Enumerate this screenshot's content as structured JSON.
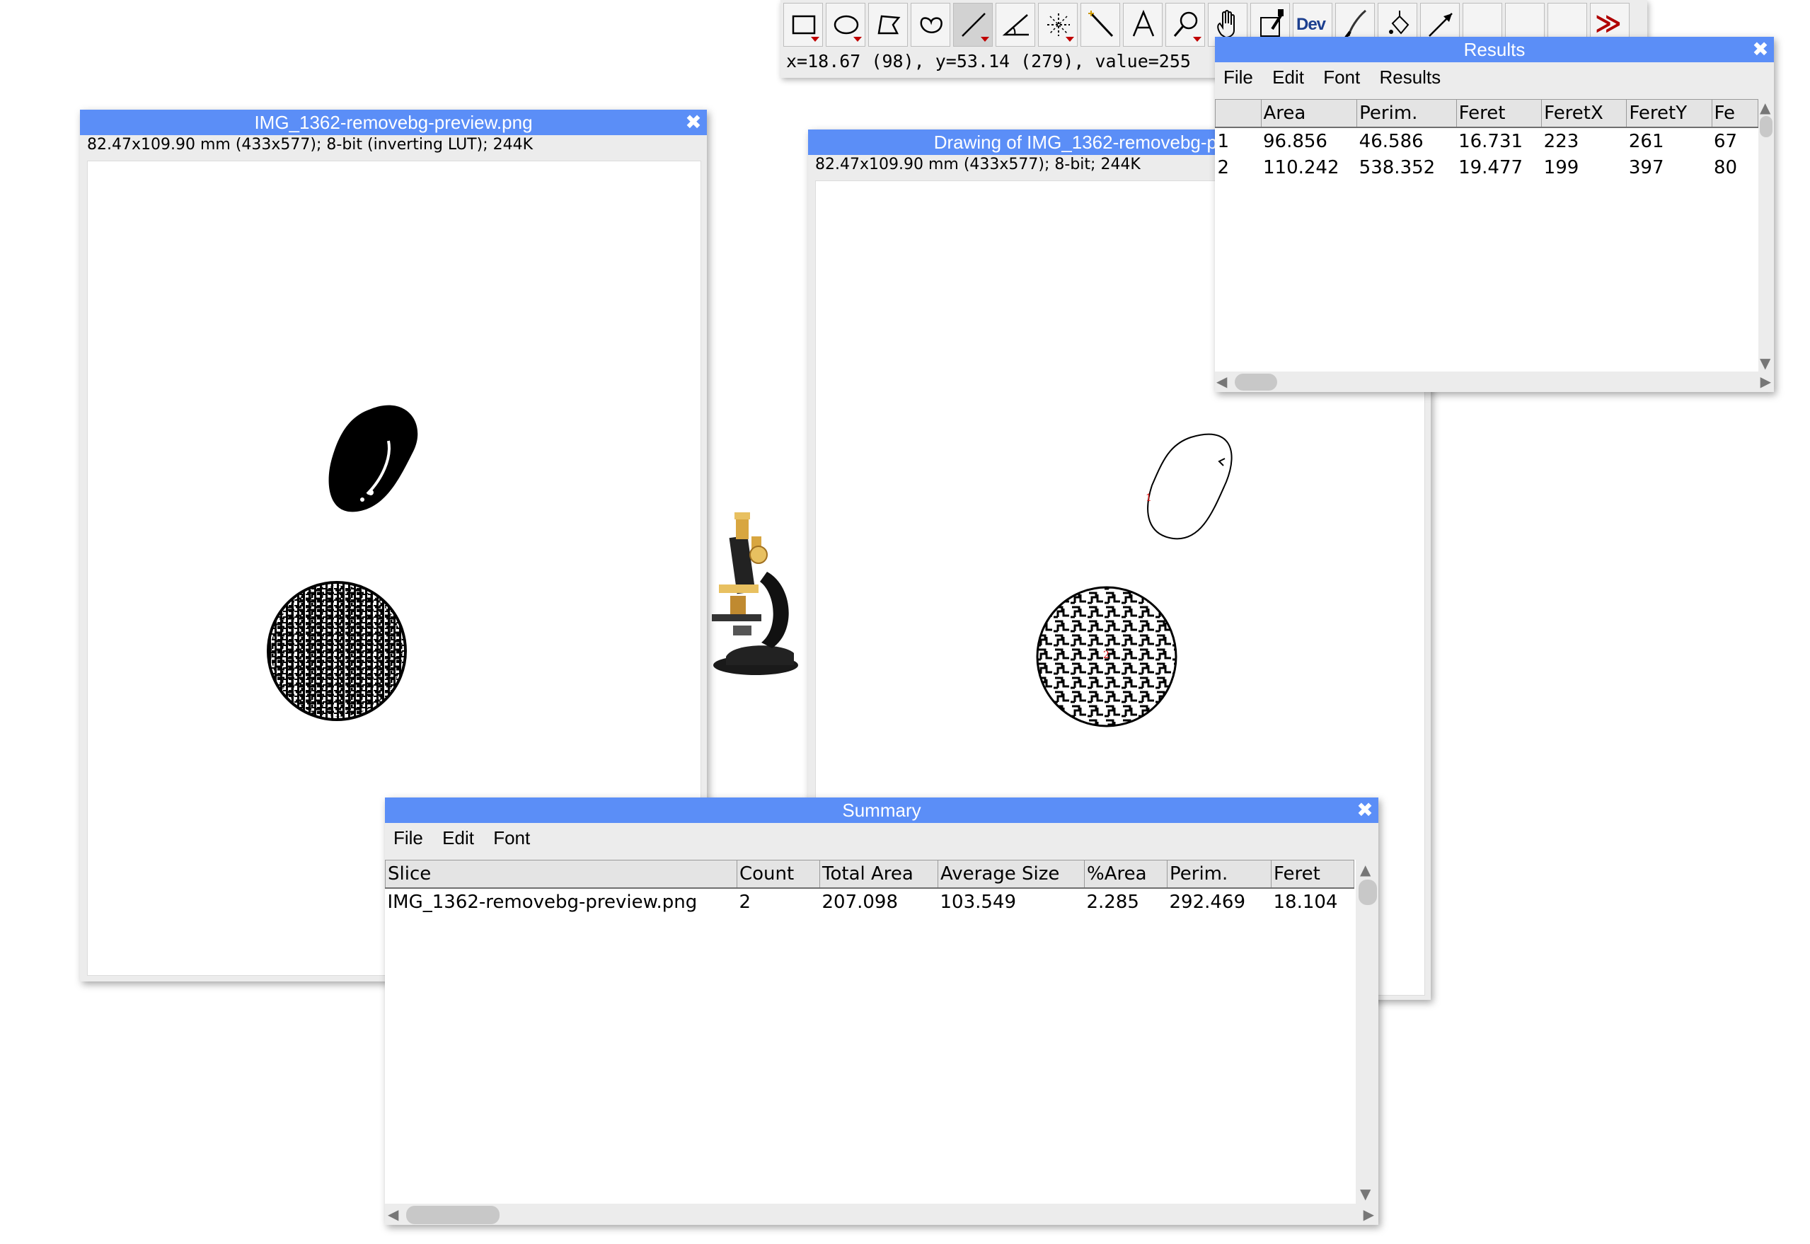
{
  "toolbar": {
    "status": "x=18.67 (98), y=53.14 (279), value=255",
    "tools": [
      {
        "name": "rectangle-tool-icon"
      },
      {
        "name": "oval-tool-icon"
      },
      {
        "name": "polygon-tool-icon"
      },
      {
        "name": "freehand-tool-icon"
      },
      {
        "name": "line-tool-icon"
      },
      {
        "name": "angle-tool-icon"
      },
      {
        "name": "point-tool-icon"
      },
      {
        "name": "wand-tool-icon"
      },
      {
        "name": "text-tool-icon"
      },
      {
        "name": "magnifier-tool-icon"
      },
      {
        "name": "hand-tool-icon"
      },
      {
        "name": "color-picker-tool-icon"
      },
      {
        "name": "dev-menu-icon",
        "label": "Dev"
      },
      {
        "name": "brush-tool-icon"
      },
      {
        "name": "flood-fill-tool-icon"
      },
      {
        "name": "arrow-tool-icon"
      },
      {
        "name": "empty-slot-1"
      },
      {
        "name": "empty-slot-2"
      },
      {
        "name": "empty-slot-3"
      },
      {
        "name": "more-tools-icon",
        "label": "≫"
      }
    ],
    "dev_label": "Dev",
    "more_label": "≫"
  },
  "original_window": {
    "title": "IMG_1362-removebg-preview.png",
    "info": "82.47x109.90 mm (433x577); 8-bit (inverting LUT); 244K"
  },
  "drawing_window": {
    "title": "Drawing of IMG_1362-removebg-preview.png",
    "info": "82.47x109.90 mm (433x577); 8-bit; 244K",
    "labels": [
      "1",
      "2"
    ]
  },
  "results_window": {
    "title": "Results",
    "menu": [
      "File",
      "Edit",
      "Font",
      "Results"
    ],
    "columns": [
      "",
      "Area",
      "Perim.",
      "Feret",
      "FeretX",
      "FeretY",
      "Fe"
    ],
    "rows": [
      [
        "1",
        "96.856",
        "46.586",
        "16.731",
        "223",
        "261",
        "67"
      ],
      [
        "2",
        "110.242",
        "538.352",
        "19.477",
        "199",
        "397",
        "80"
      ]
    ]
  },
  "summary_window": {
    "title": "Summary",
    "menu": [
      "File",
      "Edit",
      "Font"
    ],
    "columns": [
      "Slice",
      "Count",
      "Total Area",
      "Average Size",
      "%Area",
      "Perim.",
      "Feret"
    ],
    "rows": [
      [
        "IMG_1362-removebg-preview.png",
        "2",
        "207.098",
        "103.549",
        "2.285",
        "292.469",
        "18.104"
      ]
    ]
  },
  "colors": {
    "titlebar": "#5b8ef7",
    "frame": "#ececec",
    "label_red": "#dd1111"
  }
}
